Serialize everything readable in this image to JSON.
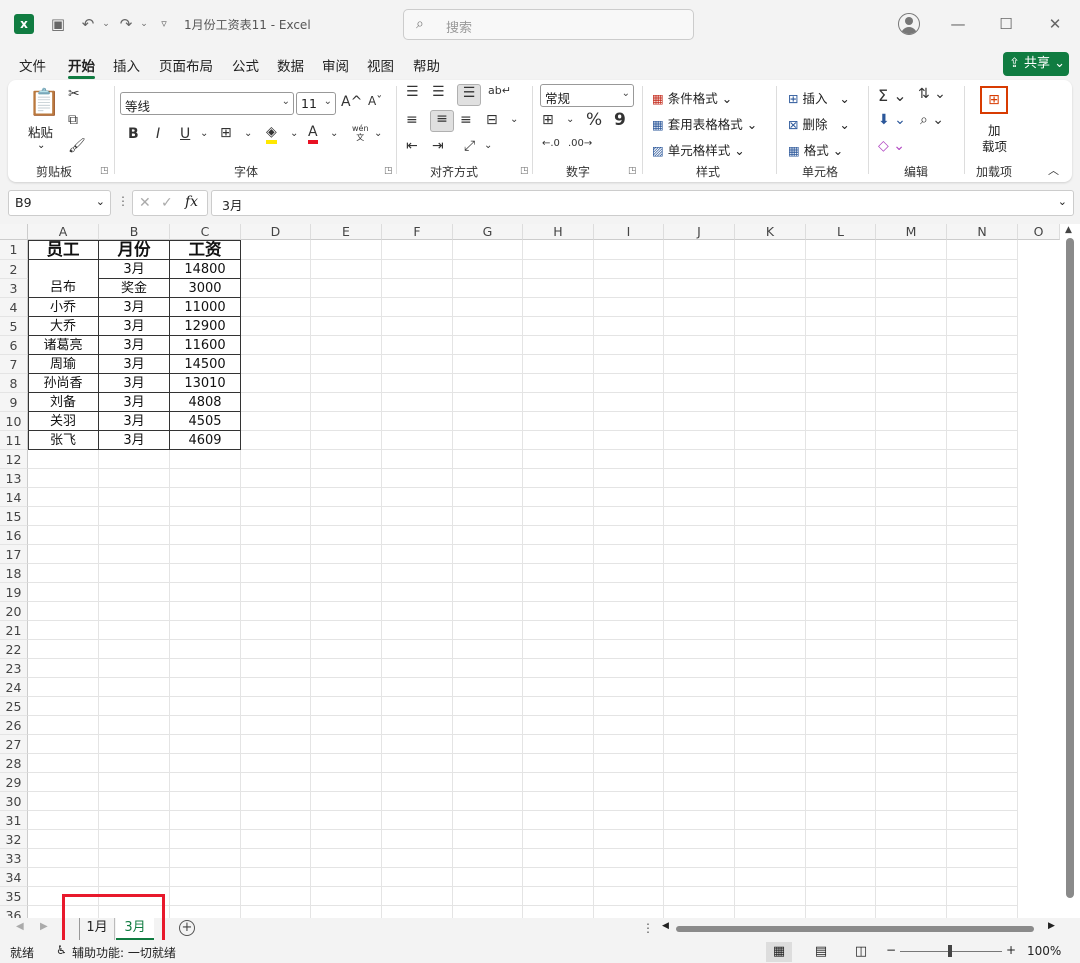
{
  "app": {
    "doc_title": "1月份工资表11  -  Excel",
    "search_placeholder": "搜索",
    "logo": "x",
    "share": "共享"
  },
  "menu": [
    "文件",
    "开始",
    "插入",
    "页面布局",
    "公式",
    "数据",
    "审阅",
    "视图",
    "帮助"
  ],
  "ribbon": {
    "clipboard": {
      "paste": "粘贴",
      "label": "剪贴板"
    },
    "font": {
      "name": "等线",
      "size": "11",
      "label": "字体",
      "bold": "B",
      "italic": "I",
      "underline": "U",
      "grow": "A^",
      "shrink": "Aˇ",
      "phonetic_top": "wén",
      "phonetic_bottom": "文"
    },
    "align": {
      "label": "对齐方式"
    },
    "number": {
      "format": "常规",
      "label": "数字",
      "percent": "%",
      "comma": "9"
    },
    "styles": {
      "cond": "条件格式",
      "table": "套用表格格式",
      "cell": "单元格样式",
      "label": "样式"
    },
    "cells": {
      "insert": "插入",
      "delete": "删除",
      "format": "格式",
      "label": "单元格"
    },
    "edit": {
      "label": "编辑"
    },
    "addins": {
      "btn_line1": "加",
      "btn_line2": "载项",
      "label": "加载项"
    }
  },
  "formula_bar": {
    "cell_ref": "B9",
    "fx": "fx",
    "value": "3月"
  },
  "columns": [
    "A",
    "B",
    "C",
    "D",
    "E",
    "F",
    "G",
    "H",
    "I",
    "J",
    "K",
    "L",
    "M",
    "N",
    "O"
  ],
  "rows": [
    "1",
    "2",
    "3",
    "4",
    "5",
    "6",
    "7",
    "8",
    "9",
    "10",
    "11",
    "12",
    "13",
    "14",
    "15",
    "16",
    "17",
    "18",
    "19",
    "20",
    "21",
    "22",
    "23",
    "24",
    "25",
    "26",
    "27",
    "28",
    "29",
    "30",
    "31",
    "32",
    "33",
    "34",
    "35",
    "36"
  ],
  "table": {
    "headers": [
      "员工",
      "月份",
      "工资"
    ],
    "merged_name": "吕布",
    "data": [
      [
        "",
        "3月",
        "14800"
      ],
      [
        "",
        "奖金",
        "3000"
      ],
      [
        "小乔",
        "3月",
        "11000"
      ],
      [
        "大乔",
        "3月",
        "12900"
      ],
      [
        "诸葛亮",
        "3月",
        "11600"
      ],
      [
        "周瑜",
        "3月",
        "14500"
      ],
      [
        "孙尚香",
        "3月",
        "13010"
      ],
      [
        "刘备",
        "3月",
        "4808"
      ],
      [
        "关羽",
        "3月",
        "4505"
      ],
      [
        "张飞",
        "3月",
        "4609"
      ]
    ]
  },
  "sheets": [
    "1月",
    "3月"
  ],
  "active_sheet": "3月",
  "status": {
    "ready": "就绪",
    "accessibility": "辅助功能: 一切就绪",
    "zoom": "100%",
    "minus": "−",
    "plus": "+"
  },
  "colors": {
    "accent": "#107c41",
    "highlight_box": "#e8192c"
  }
}
